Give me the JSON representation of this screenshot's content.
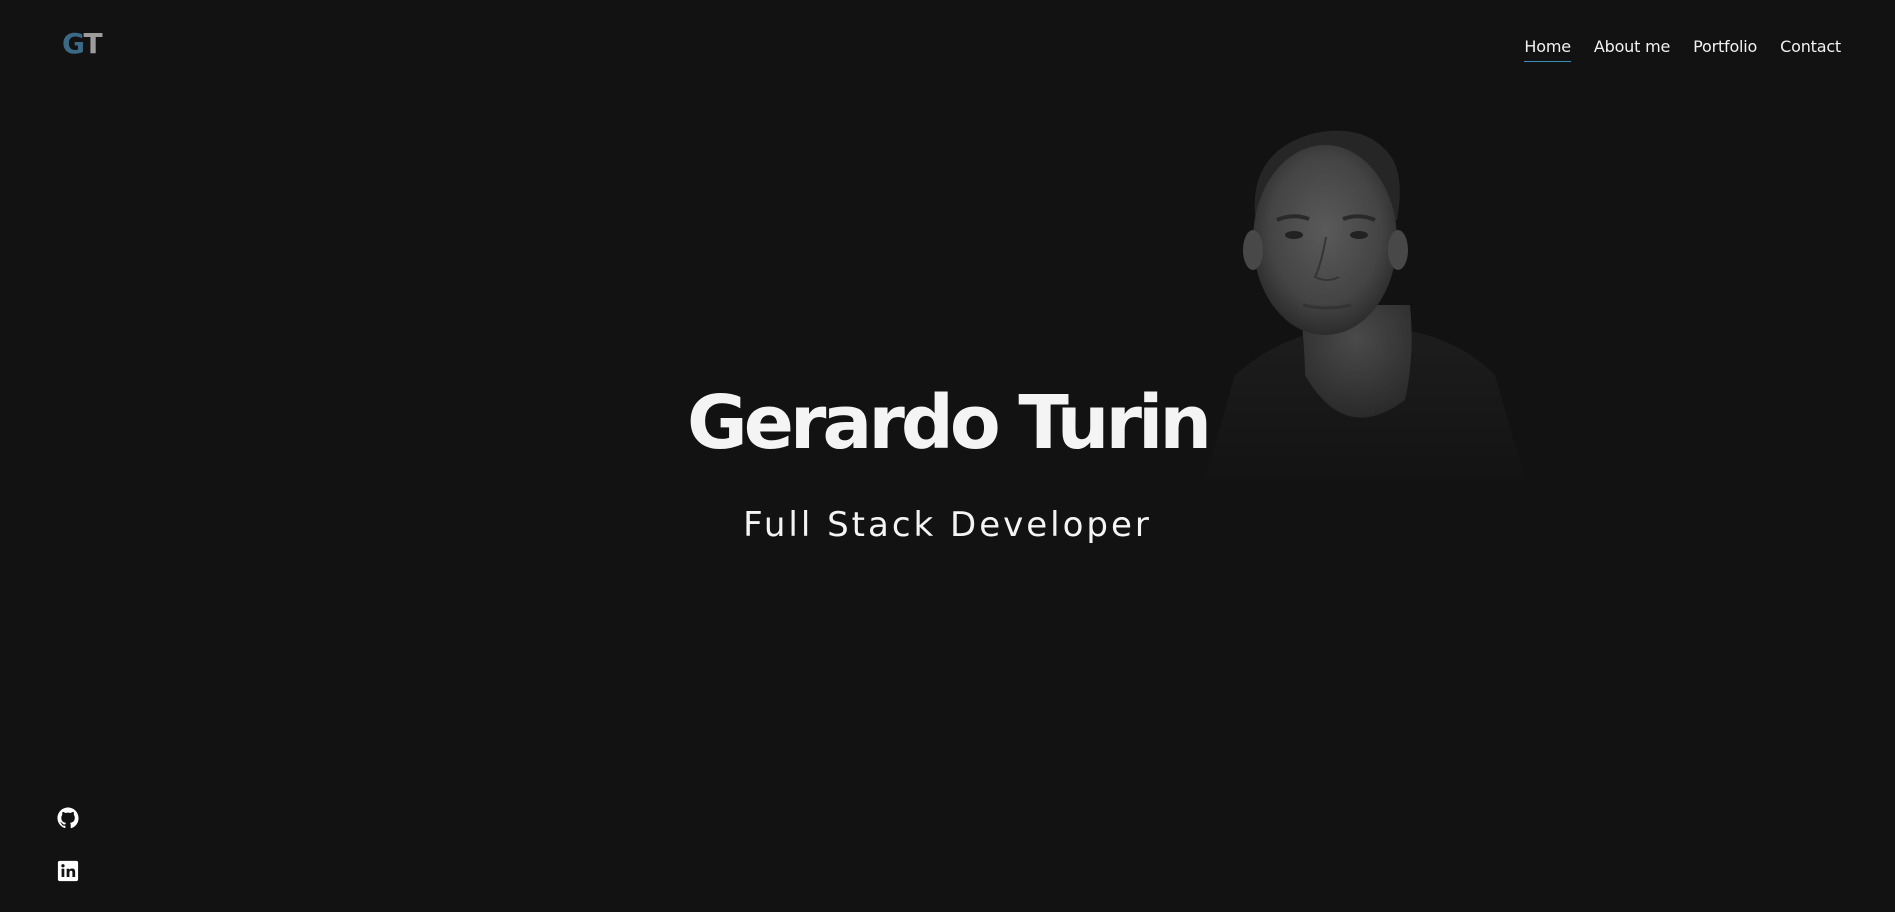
{
  "brand": {
    "logo_first": "G",
    "logo_second": "T",
    "logo_first_color": "#3b6a86",
    "logo_second_color": "#9c9c9c"
  },
  "nav": {
    "items": [
      {
        "label": "Home",
        "active": true
      },
      {
        "label": "About me",
        "active": false
      },
      {
        "label": "Portfolio",
        "active": false
      },
      {
        "label": "Contact",
        "active": false
      }
    ],
    "active_underline_color": "#3b8fb8"
  },
  "hero": {
    "name": "Gerardo Turin",
    "role": "Full Stack Developer",
    "portrait": "grayscale-portrait-photo"
  },
  "social": {
    "items": [
      {
        "icon": "github-icon"
      },
      {
        "icon": "linkedin-icon"
      }
    ]
  },
  "colors": {
    "background": "#121212",
    "text": "#f4f4f4"
  }
}
